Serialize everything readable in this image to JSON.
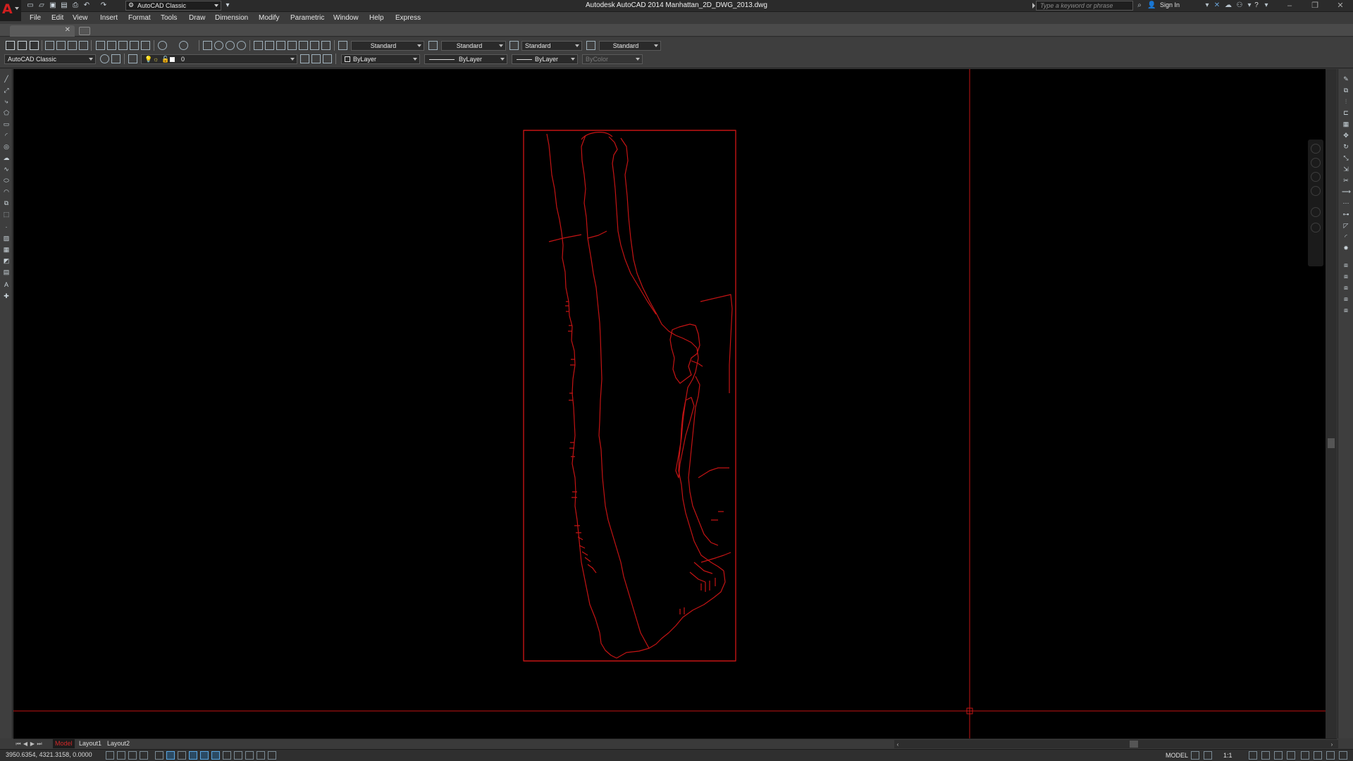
{
  "titlebar": {
    "title": "Autodesk AutoCAD 2014    Manhattan_2D_DWG_2013.dwg",
    "workspace": "AutoCAD Classic",
    "search_placeholder": "Type a keyword or phrase",
    "signin": "Sign In",
    "quick_access": [
      "new-icon",
      "open-icon",
      "save-icon",
      "saveas-icon",
      "print-icon",
      "undo-icon",
      "redo-icon"
    ]
  },
  "menu": [
    "File",
    "Edit",
    "View",
    "Insert",
    "Format",
    "Tools",
    "Draw",
    "Dimension",
    "Modify",
    "Parametric",
    "Window",
    "Help",
    "Express"
  ],
  "styles": {
    "text_style": "Standard",
    "dim_style": "Standard",
    "table_style": "Standard",
    "multileader_style": "Standard"
  },
  "properties": {
    "workspace": "AutoCAD Classic",
    "layer": "0",
    "color": "ByLayer",
    "linetype": "ByLayer",
    "lineweight": "ByLayer",
    "plotstyle": "ByColor"
  },
  "layout_tabs": [
    "Model",
    "Layout1",
    "Layout2"
  ],
  "status": {
    "coordinates": "3950.6354, 4321.3158, 0.0000",
    "space": "MODEL",
    "annotation_scale": "1:1"
  },
  "colors": {
    "background": "#000000",
    "drawing_red": "#c41414",
    "accent": "#d11f1f"
  },
  "icons": [
    "acad-logo-icon",
    "search-icon",
    "user-icon",
    "exchange-icon",
    "help-icon",
    "gear-icon"
  ]
}
